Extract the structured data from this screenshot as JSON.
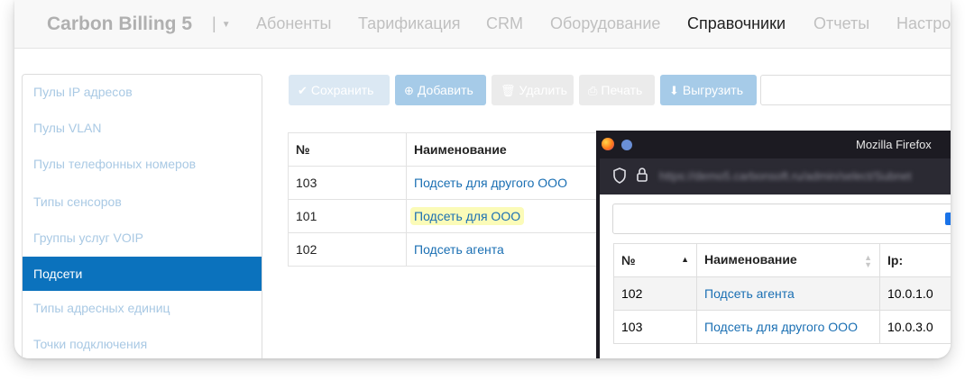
{
  "navbar": {
    "brand": "Carbon Billing 5",
    "separator": "|",
    "items": [
      "Абоненты",
      "Тарификация",
      "CRM",
      "Оборудование",
      "Справочники",
      "Отчеты",
      "Настро"
    ]
  },
  "sidebar": {
    "items": [
      {
        "label": "Пулы IP адресов"
      },
      {
        "label": "Пулы VLAN"
      },
      {
        "label": "Пулы телефонных номеров"
      },
      {
        "label": "Типы сенсоров"
      },
      {
        "label": "Группы услуг VOIP"
      },
      {
        "label": "Подсети"
      },
      {
        "label": "Типы адресных единиц"
      },
      {
        "label": "Точки подключения"
      }
    ]
  },
  "toolbar": {
    "save_label": "Сохранить",
    "add_label": "Добавить",
    "delete_label": "Удалить",
    "print_label": "Печать",
    "export_label": "Выгрузить"
  },
  "main_table": {
    "headers": [
      "№",
      "Наименование"
    ],
    "rows": [
      {
        "id": "103",
        "name": "Подсеть для другого ООО"
      },
      {
        "id": "101",
        "name": "Подсеть для ООО"
      },
      {
        "id": "102",
        "name": "Подсеть агента"
      }
    ]
  },
  "popup": {
    "window_title": "Mozilla Firefox",
    "url": "https://demo5.carbonsoft.ru/admin/select/Subnet",
    "table": {
      "headers": [
        "№",
        "Наименование",
        "Ip:"
      ],
      "rows": [
        {
          "id": "102",
          "name": "Подсеть агента",
          "ip": "10.0.1.0"
        },
        {
          "id": "103",
          "name": "Подсеть для другого ООО",
          "ip": "10.0.3.0"
        }
      ]
    }
  },
  "colors": {
    "active_sidebar": "#0b72bd",
    "link": "#1a6fb3",
    "highlight": "#fbfbb8"
  }
}
